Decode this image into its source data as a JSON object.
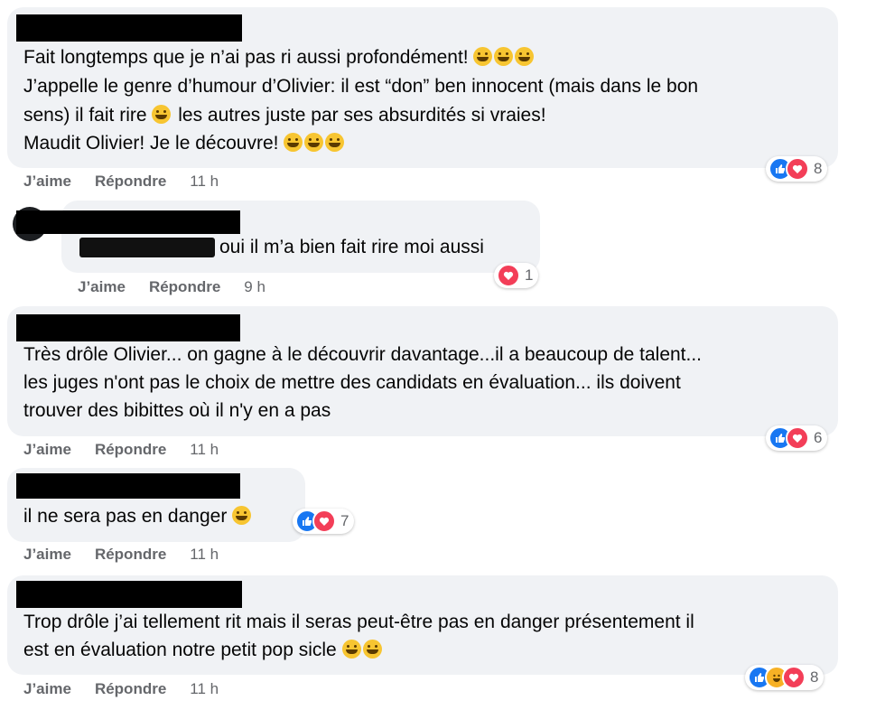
{
  "actions": {
    "like": "J’aime",
    "reply": "Répondre"
  },
  "comments": [
    {
      "lines": [
        "Fait longtemps que je n’ai pas ri aussi profondément!",
        "J’appelle le genre d’humour d’Olivier: il est “don” ben innocent (mais dans le bon",
        "sens) il fait rire",
        "les autres juste par ses absurdités si vraies!",
        "Maudit Olivier! Je le découvre!"
      ],
      "time": "11 h",
      "reactions": {
        "icons": [
          "like-icon",
          "love-icon"
        ],
        "count": "8"
      }
    },
    {
      "lines": [
        "oui il m’a bien fait rire moi aussi"
      ],
      "time": "9 h",
      "reactions": {
        "icons": [
          "love-icon"
        ],
        "count": "1"
      }
    },
    {
      "lines": [
        "Très drôle Olivier... on gagne à le découvrir davantage...il a beaucoup de talent...",
        "les juges n'ont pas le choix de mettre des candidats en évaluation... ils doivent",
        "trouver des bibittes où il n'y en a pas"
      ],
      "time": "11 h",
      "reactions": {
        "icons": [
          "like-icon",
          "love-icon"
        ],
        "count": "6"
      }
    },
    {
      "lines": [
        "il ne sera pas en danger"
      ],
      "time": "11 h",
      "reactions": {
        "icons": [
          "like-icon",
          "love-icon"
        ],
        "count": "7"
      }
    },
    {
      "lines": [
        "Trop drôle j’ai tellement rit mais il seras peut-être pas en danger présentement il",
        "est en évaluation notre petit pop sicle"
      ],
      "time": "11 h",
      "reactions": {
        "icons": [
          "like-icon",
          "haha-icon",
          "love-icon"
        ],
        "count": "8"
      }
    }
  ]
}
